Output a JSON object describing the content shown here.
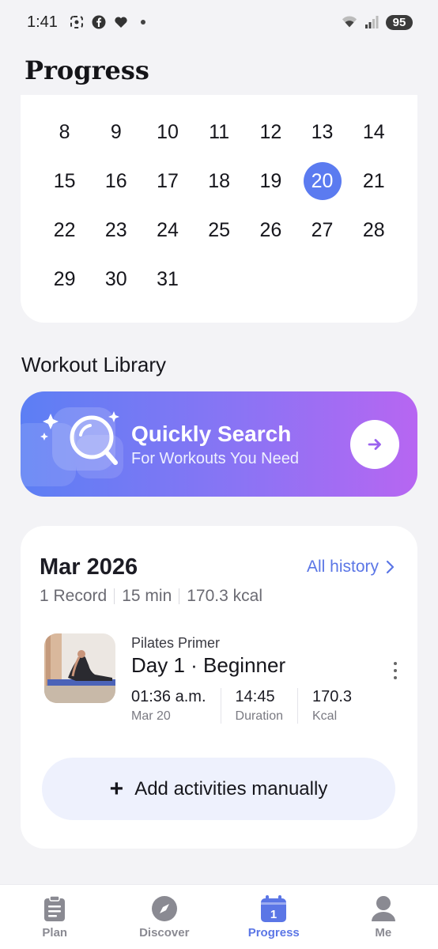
{
  "status_bar": {
    "time": "1:41",
    "battery": "95",
    "icons": [
      "screenshot-icon",
      "facebook-icon",
      "heart-icon",
      "dot-icon",
      "wifi-icon",
      "signal-icon"
    ]
  },
  "header": {
    "title": "Progress"
  },
  "calendar": {
    "days": [
      "8",
      "9",
      "10",
      "11",
      "12",
      "13",
      "14",
      "15",
      "16",
      "17",
      "18",
      "19",
      "20",
      "21",
      "22",
      "23",
      "24",
      "25",
      "26",
      "27",
      "28",
      "29",
      "30",
      "31"
    ],
    "selected_day": "20",
    "accent_color": "#5b7bf0"
  },
  "workout_library": {
    "title": "Workout Library",
    "banner": {
      "title": "Quickly Search",
      "subtitle": "For Workouts You Need",
      "icon": "magnifier-icon",
      "gradient": [
        "#5c7ff4",
        "#b766f2"
      ]
    }
  },
  "history": {
    "month": "Mar 2026",
    "all_history_label": "All history",
    "summary": {
      "records": "1 Record",
      "duration": "15 min",
      "calories": "170.3 kcal"
    },
    "record": {
      "program": "Pilates Primer",
      "title": "Day 1 · Beginner",
      "stats": [
        {
          "value": "01:36 a.m.",
          "label": "Mar 20"
        },
        {
          "value": "14:45",
          "label": "Duration"
        },
        {
          "value": "170.3",
          "label": "Kcal"
        }
      ]
    },
    "add_label": "Add activities manually"
  },
  "bottom_nav": {
    "items": [
      {
        "label": "Plan",
        "icon": "clipboard-icon"
      },
      {
        "label": "Discover",
        "icon": "compass-icon"
      },
      {
        "label": "Progress",
        "icon": "calendar-icon",
        "badge": "1"
      },
      {
        "label": "Me",
        "icon": "person-icon"
      }
    ],
    "active": "Progress",
    "active_color": "#5b76e6"
  }
}
